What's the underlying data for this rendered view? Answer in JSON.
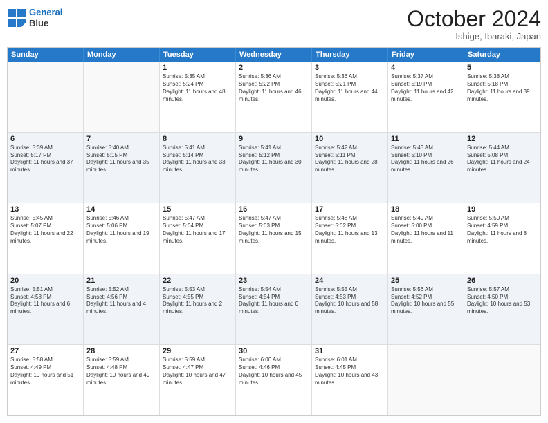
{
  "header": {
    "logo_line1": "General",
    "logo_line2": "Blue",
    "month": "October 2024",
    "location": "Ishige, Ibaraki, Japan"
  },
  "days_of_week": [
    "Sunday",
    "Monday",
    "Tuesday",
    "Wednesday",
    "Thursday",
    "Friday",
    "Saturday"
  ],
  "weeks": [
    [
      {
        "day": "",
        "text": ""
      },
      {
        "day": "",
        "text": ""
      },
      {
        "day": "1",
        "text": "Sunrise: 5:35 AM\nSunset: 5:24 PM\nDaylight: 11 hours and 48 minutes."
      },
      {
        "day": "2",
        "text": "Sunrise: 5:36 AM\nSunset: 5:22 PM\nDaylight: 11 hours and 46 minutes."
      },
      {
        "day": "3",
        "text": "Sunrise: 5:36 AM\nSunset: 5:21 PM\nDaylight: 11 hours and 44 minutes."
      },
      {
        "day": "4",
        "text": "Sunrise: 5:37 AM\nSunset: 5:19 PM\nDaylight: 11 hours and 42 minutes."
      },
      {
        "day": "5",
        "text": "Sunrise: 5:38 AM\nSunset: 5:18 PM\nDaylight: 11 hours and 39 minutes."
      }
    ],
    [
      {
        "day": "6",
        "text": "Sunrise: 5:39 AM\nSunset: 5:17 PM\nDaylight: 11 hours and 37 minutes."
      },
      {
        "day": "7",
        "text": "Sunrise: 5:40 AM\nSunset: 5:15 PM\nDaylight: 11 hours and 35 minutes."
      },
      {
        "day": "8",
        "text": "Sunrise: 5:41 AM\nSunset: 5:14 PM\nDaylight: 11 hours and 33 minutes."
      },
      {
        "day": "9",
        "text": "Sunrise: 5:41 AM\nSunset: 5:12 PM\nDaylight: 11 hours and 30 minutes."
      },
      {
        "day": "10",
        "text": "Sunrise: 5:42 AM\nSunset: 5:11 PM\nDaylight: 11 hours and 28 minutes."
      },
      {
        "day": "11",
        "text": "Sunrise: 5:43 AM\nSunset: 5:10 PM\nDaylight: 11 hours and 26 minutes."
      },
      {
        "day": "12",
        "text": "Sunrise: 5:44 AM\nSunset: 5:08 PM\nDaylight: 11 hours and 24 minutes."
      }
    ],
    [
      {
        "day": "13",
        "text": "Sunrise: 5:45 AM\nSunset: 5:07 PM\nDaylight: 11 hours and 22 minutes."
      },
      {
        "day": "14",
        "text": "Sunrise: 5:46 AM\nSunset: 5:06 PM\nDaylight: 11 hours and 19 minutes."
      },
      {
        "day": "15",
        "text": "Sunrise: 5:47 AM\nSunset: 5:04 PM\nDaylight: 11 hours and 17 minutes."
      },
      {
        "day": "16",
        "text": "Sunrise: 5:47 AM\nSunset: 5:03 PM\nDaylight: 11 hours and 15 minutes."
      },
      {
        "day": "17",
        "text": "Sunrise: 5:48 AM\nSunset: 5:02 PM\nDaylight: 11 hours and 13 minutes."
      },
      {
        "day": "18",
        "text": "Sunrise: 5:49 AM\nSunset: 5:00 PM\nDaylight: 11 hours and 11 minutes."
      },
      {
        "day": "19",
        "text": "Sunrise: 5:50 AM\nSunset: 4:59 PM\nDaylight: 11 hours and 8 minutes."
      }
    ],
    [
      {
        "day": "20",
        "text": "Sunrise: 5:51 AM\nSunset: 4:58 PM\nDaylight: 11 hours and 6 minutes."
      },
      {
        "day": "21",
        "text": "Sunrise: 5:52 AM\nSunset: 4:56 PM\nDaylight: 11 hours and 4 minutes."
      },
      {
        "day": "22",
        "text": "Sunrise: 5:53 AM\nSunset: 4:55 PM\nDaylight: 11 hours and 2 minutes."
      },
      {
        "day": "23",
        "text": "Sunrise: 5:54 AM\nSunset: 4:54 PM\nDaylight: 11 hours and 0 minutes."
      },
      {
        "day": "24",
        "text": "Sunrise: 5:55 AM\nSunset: 4:53 PM\nDaylight: 10 hours and 58 minutes."
      },
      {
        "day": "25",
        "text": "Sunrise: 5:56 AM\nSunset: 4:52 PM\nDaylight: 10 hours and 55 minutes."
      },
      {
        "day": "26",
        "text": "Sunrise: 5:57 AM\nSunset: 4:50 PM\nDaylight: 10 hours and 53 minutes."
      }
    ],
    [
      {
        "day": "27",
        "text": "Sunrise: 5:58 AM\nSunset: 4:49 PM\nDaylight: 10 hours and 51 minutes."
      },
      {
        "day": "28",
        "text": "Sunrise: 5:59 AM\nSunset: 4:48 PM\nDaylight: 10 hours and 49 minutes."
      },
      {
        "day": "29",
        "text": "Sunrise: 5:59 AM\nSunset: 4:47 PM\nDaylight: 10 hours and 47 minutes."
      },
      {
        "day": "30",
        "text": "Sunrise: 6:00 AM\nSunset: 4:46 PM\nDaylight: 10 hours and 45 minutes."
      },
      {
        "day": "31",
        "text": "Sunrise: 6:01 AM\nSunset: 4:45 PM\nDaylight: 10 hours and 43 minutes."
      },
      {
        "day": "",
        "text": ""
      },
      {
        "day": "",
        "text": ""
      }
    ]
  ]
}
